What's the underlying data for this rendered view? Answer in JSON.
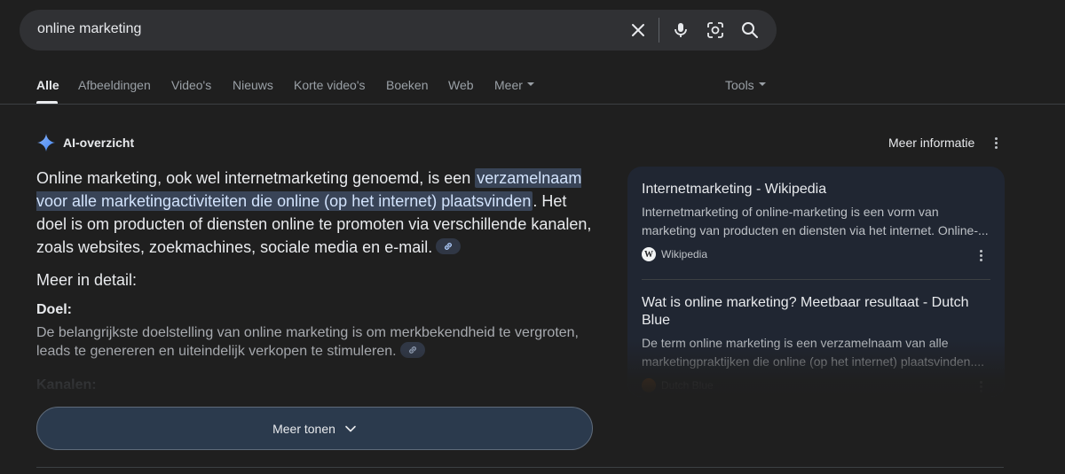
{
  "search": {
    "query": "online marketing",
    "clear_icon": "close-icon",
    "voice_icon": "mic-icon",
    "lens_icon": "camera-lens-icon",
    "search_icon": "search-icon"
  },
  "tabs": [
    {
      "label": "Alle",
      "active": true
    },
    {
      "label": "Afbeeldingen"
    },
    {
      "label": "Video's"
    },
    {
      "label": "Nieuws"
    },
    {
      "label": "Korte video's"
    },
    {
      "label": "Boeken"
    },
    {
      "label": "Web"
    },
    {
      "label": "Meer"
    }
  ],
  "tools_label": "Tools",
  "ai_overview": {
    "title": "AI-overzicht",
    "more_info": "Meer informatie",
    "para_part1": "Online marketing, ook wel internetmarketing genoemd, is een ",
    "para_highlight": "verzamelnaam voor alle marketingactiviteiten die online (op het internet) plaatsvinden",
    "para_part2": ". Het doel is om producten of diensten online te promoten via verschillende kanalen, zoals websites, zoekmachines, sociale media en e-mail.",
    "detail_heading": "Meer in detail:",
    "goal_label": "Doel:",
    "goal_text": "De belangrijkste doelstelling van online marketing is om merkbekendheid te vergroten, leads te genereren en uiteindelijk verkopen te stimuleren.",
    "channels_label": "Kanalen:",
    "show_more": "Meer tonen"
  },
  "sources": [
    {
      "title": "Internetmarketing - Wikipedia",
      "snippet_line1": "Internetmarketing of online-marketing is een vorm van",
      "snippet_line2": "marketing van producten en diensten via het internet. Online-...",
      "site": "Wikipedia",
      "logo_letter": "W"
    },
    {
      "title": "Wat is online marketing? Meetbaar resultaat - Dutch Blue",
      "snippet_line1": "De term online marketing is een verzamelnaam van alle",
      "snippet_line2": "marketingpraktijken die online (op het internet) plaatsvinden....",
      "site": "Dutch Blue"
    }
  ],
  "colors": {
    "background": "#1f1f1f",
    "search_bar": "#303134",
    "highlight": "#394457",
    "show_more_button": "#2b3a4d",
    "source_panel": "#202632"
  }
}
